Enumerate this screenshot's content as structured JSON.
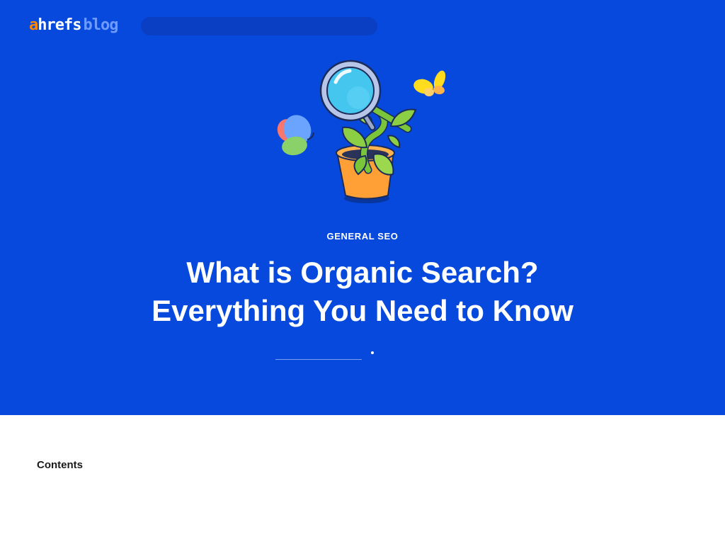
{
  "header": {
    "logo": {
      "part1": "a",
      "part2": "hrefs",
      "part3": "blog"
    },
    "search": {
      "placeholder": ""
    }
  },
  "hero": {
    "illustration_icon": "magnifier-plant-butterflies-illustration",
    "category": "GENERAL SEO",
    "title_line1": "What is Organic Search?",
    "title_line2": "Everything You Need to Know"
  },
  "main": {
    "contents_label": "Contents"
  },
  "colors": {
    "hero_background": "#0649dc",
    "logo_accent": "#ff8800",
    "logo_blog": "#6e9bff",
    "page_background": "#ffffff"
  }
}
